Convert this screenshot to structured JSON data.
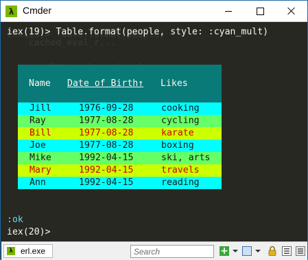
{
  "window": {
    "title": "Cmder",
    "app_icon_glyph": "λ"
  },
  "terminal": {
    "ghost_lines": [
      "iex(19)> Table.format(people)",
      "    cached_eval_r...",
      "",
      "",
      "    (stdlib) erl_eval.erl:...",
      "    (elixir) src/elixir.erl:...",
      "",
      "",
      "    {:error, ...}",
      "",
      "    (iex) lib/iex/evaluator.ex:..."
    ],
    "command_prompt": "iex(19)>",
    "command": "Table.format(people, style: :cyan_mult)",
    "result": ":ok",
    "next_prompt": "iex(20)>"
  },
  "table": {
    "headers": {
      "name": "Name",
      "dob": "Date of Birth↑",
      "likes": "Likes"
    },
    "rows": [
      {
        "name": "Jill",
        "dob": "1976-09-28",
        "likes": "cooking"
      },
      {
        "name": "Ray",
        "dob": "1977-08-28",
        "likes": "cycling"
      },
      {
        "name": "Bill",
        "dob": "1977-08-28",
        "likes": "karate"
      },
      {
        "name": "Joe",
        "dob": "1977-08-28",
        "likes": "boxing"
      },
      {
        "name": "Mike",
        "dob": "1992-04-15",
        "likes": "ski, arts"
      },
      {
        "name": "Mary",
        "dob": "1992-04-15",
        "likes": "travels"
      },
      {
        "name": "Ann",
        "dob": "1992-04-15",
        "likes": "reading"
      }
    ],
    "colors": {
      "background": "#0a7a78",
      "header_text": "#f8f8f2",
      "row_backgrounds": [
        "#00ffff",
        "#66ff66",
        "#ccff00",
        "#00ffff",
        "#66ff66",
        "#ccff00",
        "#00ffff"
      ],
      "row_text": [
        "#1a1a1a",
        "#1a1a1a",
        "#cc0000",
        "#1a1a1a",
        "#1a1a1a",
        "#cc0000",
        "#1a1a1a"
      ]
    }
  },
  "statusbar": {
    "tab_label": "erl.exe",
    "search_placeholder": "Search"
  },
  "icons": {
    "app": "lambda-icon",
    "minimize": "minimize-icon",
    "maximize": "maximize-icon",
    "close": "close-icon",
    "new_console": "plus-icon",
    "view": "view-icon",
    "lock": "lock-icon",
    "list": "list-icon",
    "menu": "menu-icon"
  }
}
